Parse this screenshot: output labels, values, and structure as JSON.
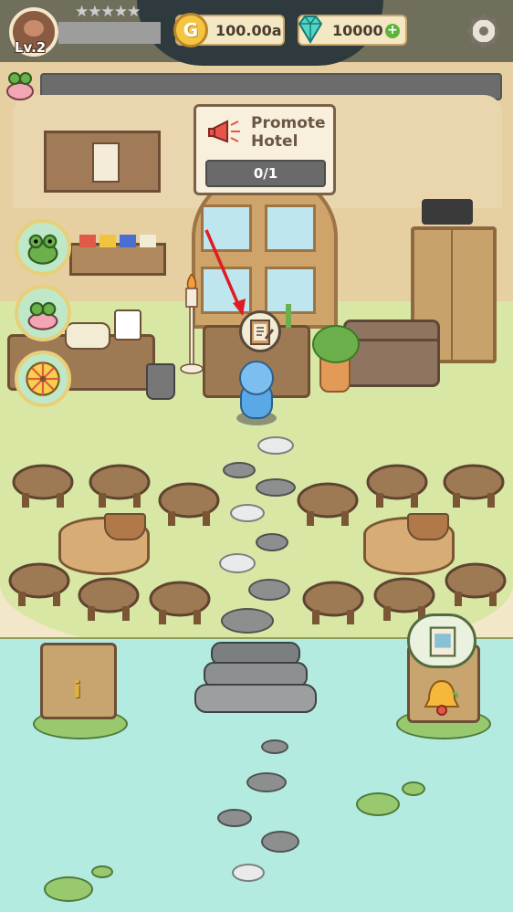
{
  "hud": {
    "level": "Lv.2",
    "stars_total": 5,
    "stars_filled": 0,
    "gold": "100.00a",
    "gems": "10000",
    "gold_icon_letter": "G",
    "plus_glyph": "+"
  },
  "promote": {
    "title": "Promote\nHotel",
    "progress": "0/1",
    "progress_value": 0,
    "progress_total": 1
  },
  "info_post": {
    "glyph": "i"
  },
  "colors": {
    "accent_gold": "#f5c542",
    "gem": "#4fd6c6",
    "plus": "#5fb23f",
    "lake": "#b3ebe0",
    "tutorial_arrow": "#e01b24"
  },
  "icons": [
    "settings-gear-icon",
    "gold-coin-icon",
    "gem-icon",
    "megaphone-icon",
    "clipboard-icon",
    "bell-icon",
    "frog-icon",
    "wheel-icon",
    "info-icon",
    "shell-icon"
  ]
}
